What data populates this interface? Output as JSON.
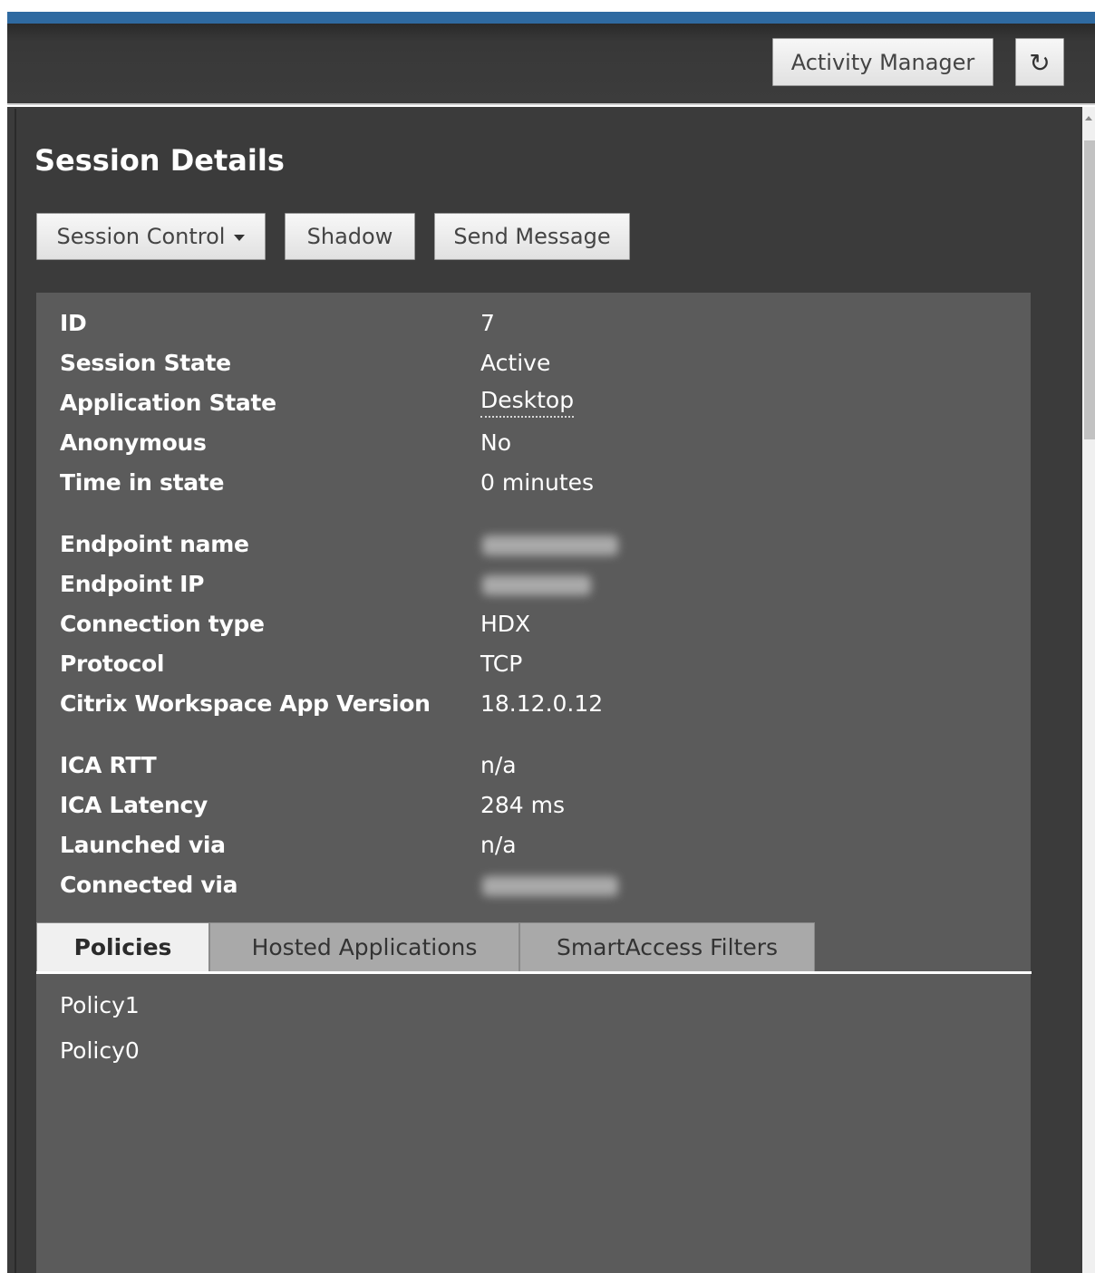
{
  "header": {
    "activity_manager_label": "Activity Manager",
    "refresh_icon": "↻"
  },
  "panel": {
    "title": "Session Details",
    "buttons": {
      "session_control": "Session Control",
      "shadow": "Shadow",
      "send_message": "Send Message"
    }
  },
  "details": {
    "rows": [
      {
        "label": "ID",
        "value": "7"
      },
      {
        "label": "Session State",
        "value": "Active"
      },
      {
        "label": "Application State",
        "value": "Desktop"
      },
      {
        "label": "Anonymous",
        "value": "No"
      },
      {
        "label": "Time in state",
        "value": "0 minutes"
      },
      {
        "label": "Endpoint name",
        "value": null,
        "redacted": true
      },
      {
        "label": "Endpoint IP",
        "value": null,
        "redacted": true
      },
      {
        "label": "Connection type",
        "value": "HDX"
      },
      {
        "label": "Protocol",
        "value": "TCP"
      },
      {
        "label": "Citrix Workspace App Version",
        "value": "18.12.0.12"
      },
      {
        "label": "ICA RTT",
        "value": "n/a"
      },
      {
        "label": "ICA Latency",
        "value": "284 ms"
      },
      {
        "label": "Launched via",
        "value": "n/a"
      },
      {
        "label": "Connected via",
        "value": null,
        "redacted": true
      }
    ]
  },
  "tabs": [
    {
      "label": "Policies",
      "active": true
    },
    {
      "label": "Hosted Applications",
      "active": false
    },
    {
      "label": "SmartAccess Filters",
      "active": false
    }
  ],
  "policies": [
    "Policy1",
    "Policy0"
  ],
  "colors": {
    "accent": "#2f6aa1",
    "panel_bg": "#3b3b3b",
    "details_bg": "#5b5b5b"
  }
}
